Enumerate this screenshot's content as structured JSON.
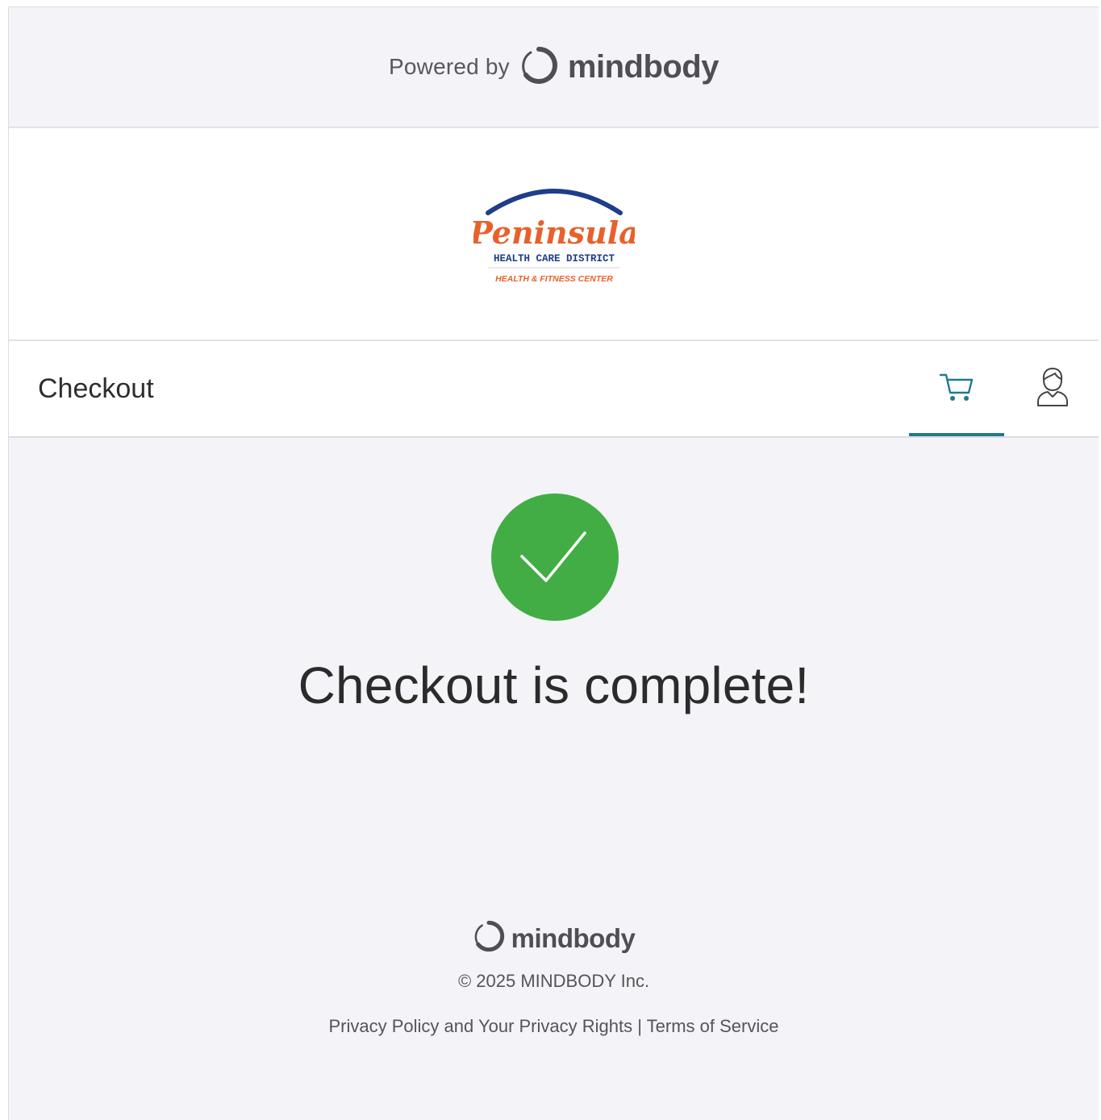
{
  "powered_bar": {
    "prefix": "Powered by",
    "brand": "mindbody"
  },
  "business_logo": {
    "icon": "peninsula-health-care-district-logo",
    "name": "Peninsula",
    "line2": "HEALTH CARE DISTRICT",
    "line3": "HEALTH & FITNESS CENTER",
    "colors": {
      "arc": "#1f3d8a",
      "name": "#e8602c",
      "line2": "#1f3d8a",
      "line3": "#e8602c"
    }
  },
  "nav": {
    "title": "Checkout",
    "cart_icon": "shopping-cart-icon",
    "profile_icon": "user-profile-icon",
    "accent_color": "#1f7a8c"
  },
  "status": {
    "icon": "checkmark-icon",
    "color": "#42ad44",
    "message": "Checkout is complete!"
  },
  "footer": {
    "brand": "mindbody",
    "copyright": "© 2025 MINDBODY Inc.",
    "privacy_link": "Privacy Policy and Your Privacy Rights",
    "separator": "|",
    "terms_link": "Terms of Service"
  }
}
